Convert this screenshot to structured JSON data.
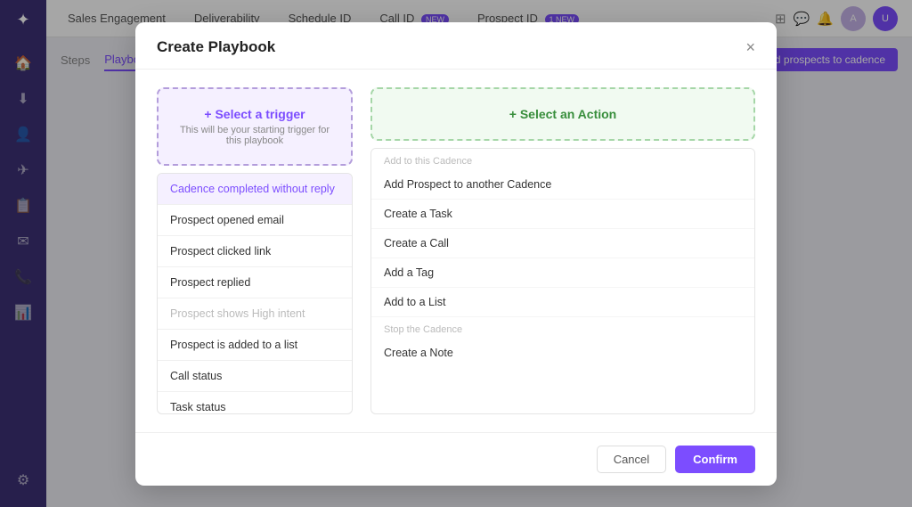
{
  "app": {
    "title": "Sales Engagement"
  },
  "nav": {
    "items": [
      {
        "label": "Sales Engagement"
      },
      {
        "label": "Deliverability"
      },
      {
        "label": "Schedule ID"
      },
      {
        "label": "Call ID",
        "badge": "NEW"
      },
      {
        "label": "Prospect ID",
        "badge": "1 NEW"
      }
    ]
  },
  "tabs": {
    "items": [
      {
        "label": "Steps"
      },
      {
        "label": "Playbooks",
        "active": true
      }
    ],
    "addButton": "Add prospects to cadence"
  },
  "modal": {
    "title": "Create Playbook",
    "closeLabel": "×",
    "trigger": {
      "selectLabel": "+ Select a trigger",
      "selectSub": "This will be your starting trigger for this playbook",
      "items": [
        {
          "label": "Cadence completed without reply",
          "selected": true
        },
        {
          "label": "Prospect opened email"
        },
        {
          "label": "Prospect clicked link"
        },
        {
          "label": "Prospect replied"
        },
        {
          "label": "Prospect shows High intent",
          "disabled": true
        },
        {
          "label": "Prospect is added to a list"
        },
        {
          "label": "Call status"
        },
        {
          "label": "Task status"
        }
      ]
    },
    "action": {
      "selectLabel": "+ Select an Action",
      "sections": [
        {
          "header": "Add to this Cadence",
          "items": []
        },
        {
          "header": "",
          "items": [
            {
              "label": "Add Prospect to another Cadence"
            },
            {
              "label": "Create a Task"
            },
            {
              "label": "Create a Call"
            },
            {
              "label": "Add a Tag"
            },
            {
              "label": "Add to a List"
            }
          ]
        },
        {
          "header": "Stop the Cadence",
          "items": [
            {
              "label": "Create a Note"
            }
          ]
        }
      ]
    },
    "footer": {
      "cancelLabel": "Cancel",
      "confirmLabel": "Confirm"
    }
  },
  "sidebar": {
    "icons": [
      "🏠",
      "⬇",
      "👤",
      "✈",
      "📋",
      "✉",
      "📞",
      "📊",
      "⚙"
    ]
  }
}
